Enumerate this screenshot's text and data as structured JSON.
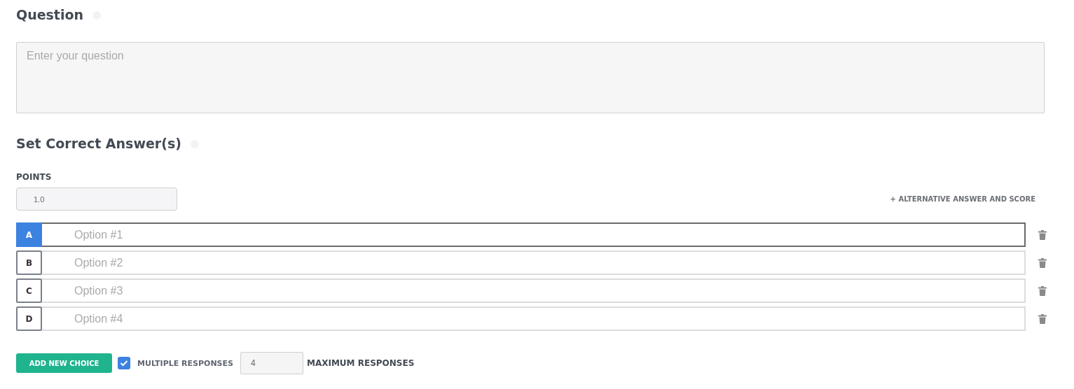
{
  "question": {
    "heading": "Question",
    "placeholder": "Enter your question"
  },
  "answers": {
    "heading": "Set Correct Answer(s)",
    "points_label": "POINTS",
    "points_value": "1.0",
    "alternative_link": "+ ALTERNATIVE ANSWER AND SCORE",
    "options": [
      {
        "letter": "A",
        "placeholder": "Option #1",
        "selected": true
      },
      {
        "letter": "B",
        "placeholder": "Option #2",
        "selected": false
      },
      {
        "letter": "C",
        "placeholder": "Option #3",
        "selected": false
      },
      {
        "letter": "D",
        "placeholder": "Option #4",
        "selected": false
      }
    ]
  },
  "footer": {
    "add_button": "ADD NEW CHOICE",
    "multiple_checked": true,
    "multiple_label": "MULTIPLE RESPONSES",
    "max_value": "4",
    "max_label": "MAXIMUM RESPONSES"
  }
}
